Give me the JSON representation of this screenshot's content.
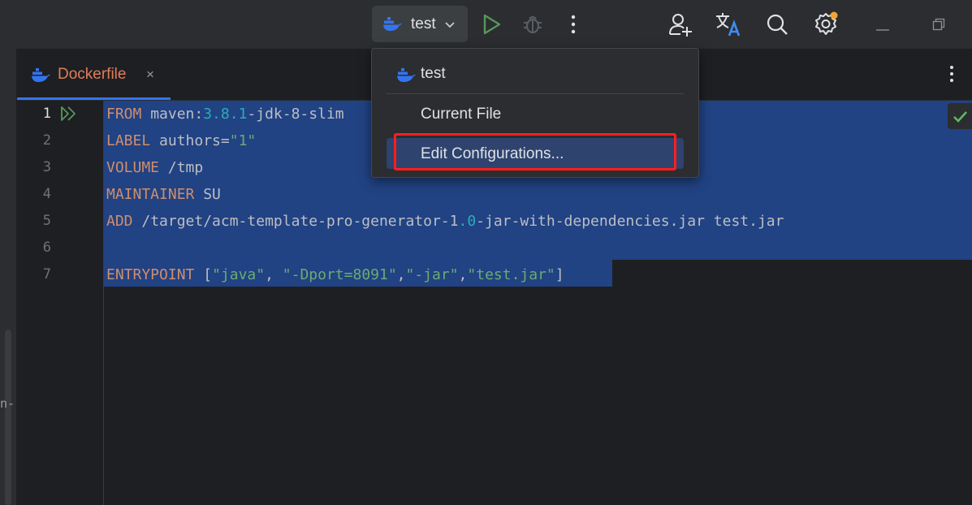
{
  "toolbar": {
    "run_config_label": "test",
    "icons": [
      "docker-icon",
      "chevron-down-icon",
      "run-icon",
      "debug-icon",
      "more-vertical-icon",
      "add-user-icon",
      "translate-icon",
      "search-icon",
      "settings-icon",
      "minimize-icon",
      "restore-icon"
    ],
    "settings_badge_color": "#f0a732"
  },
  "tab": {
    "label": "Dockerfile",
    "close": "×"
  },
  "left_strip": {
    "cut_text": "n-"
  },
  "editor": {
    "line_numbers": [
      "1",
      "2",
      "3",
      "4",
      "5",
      "6",
      "7"
    ],
    "lines": [
      {
        "kw": "FROM",
        "a": " maven:",
        "n1": "3.8.1",
        "b": "-jdk-8-slim"
      },
      {
        "kw": "LABEL",
        "a": " authors=",
        "s": "\"1\""
      },
      {
        "kw": "VOLUME",
        "a": " /tmp"
      },
      {
        "kw": "MAINTAINER",
        "a": " SU"
      },
      {
        "kw": "ADD",
        "a": " /target/acm-template-pro-generator-1",
        "n1": ".0",
        "b": "-jar-with-dependencies.jar test.jar"
      },
      {
        "kw": "",
        "a": ""
      },
      {
        "kw": "ENTRYPOINT",
        "a": " [",
        "s1": "\"java\"",
        "c1": ", ",
        "s2": "\"-Dport=8091\"",
        "c2": ",",
        "s3": "\"-jar\"",
        "c3": ",",
        "s4": "\"test.jar\"",
        "c4": "]"
      }
    ],
    "status": "check-icon"
  },
  "popup": {
    "header": "test",
    "items": [
      "Current File",
      "Edit Configurations..."
    ]
  },
  "colors": {
    "accent": "#3574f0",
    "selection": "#214283",
    "keyword": "#cf8e6d",
    "string": "#6aab73",
    "number": "#2aacb8",
    "tab_label": "#e07c5b",
    "annotation": "#ff1f1f"
  }
}
